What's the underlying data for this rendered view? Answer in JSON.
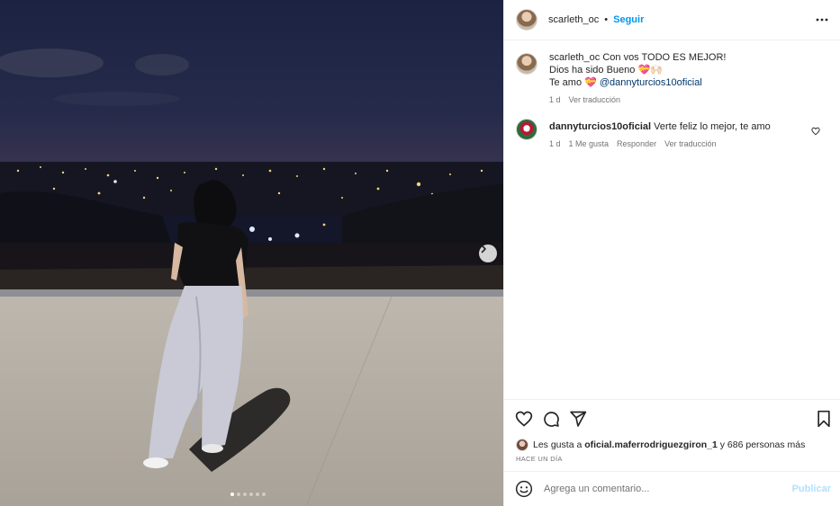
{
  "post": {
    "username": "scarleth_oc",
    "separator": "•",
    "follow_label": "Seguir",
    "more_icon": "more-horizontal-icon",
    "image_count": 6,
    "active_image": 1
  },
  "caption": {
    "username": "scarleth_oc",
    "line1": "Con vos TODO ES MEJOR!",
    "line2": "Dios ha sido Bueno 💝🙌🏻",
    "line3_prefix": "Te amo 💝 ",
    "mention": "@dannyturcios10oficial",
    "time": "1 d",
    "translate": "Ver traducción"
  },
  "comments": [
    {
      "username": "dannyturcios10oficial",
      "text": "Verte feliz lo mejor, te amo",
      "time": "1 d",
      "likes": "1 Me gusta",
      "reply": "Responder",
      "translate": "Ver traducción"
    }
  ],
  "likes": {
    "prefix": "Les gusta a ",
    "user": "oficial.maferrodriguezgiron_1",
    "suffix": " y 686 personas más"
  },
  "date_ago": "HACE UN DÍA",
  "add_comment": {
    "placeholder": "Agrega un comentario...",
    "publish_label": "Publicar"
  },
  "colors": {
    "accent": "#0095f6",
    "publish_disabled": "#b2dffc",
    "mention": "#00376b",
    "muted": "#737373"
  }
}
